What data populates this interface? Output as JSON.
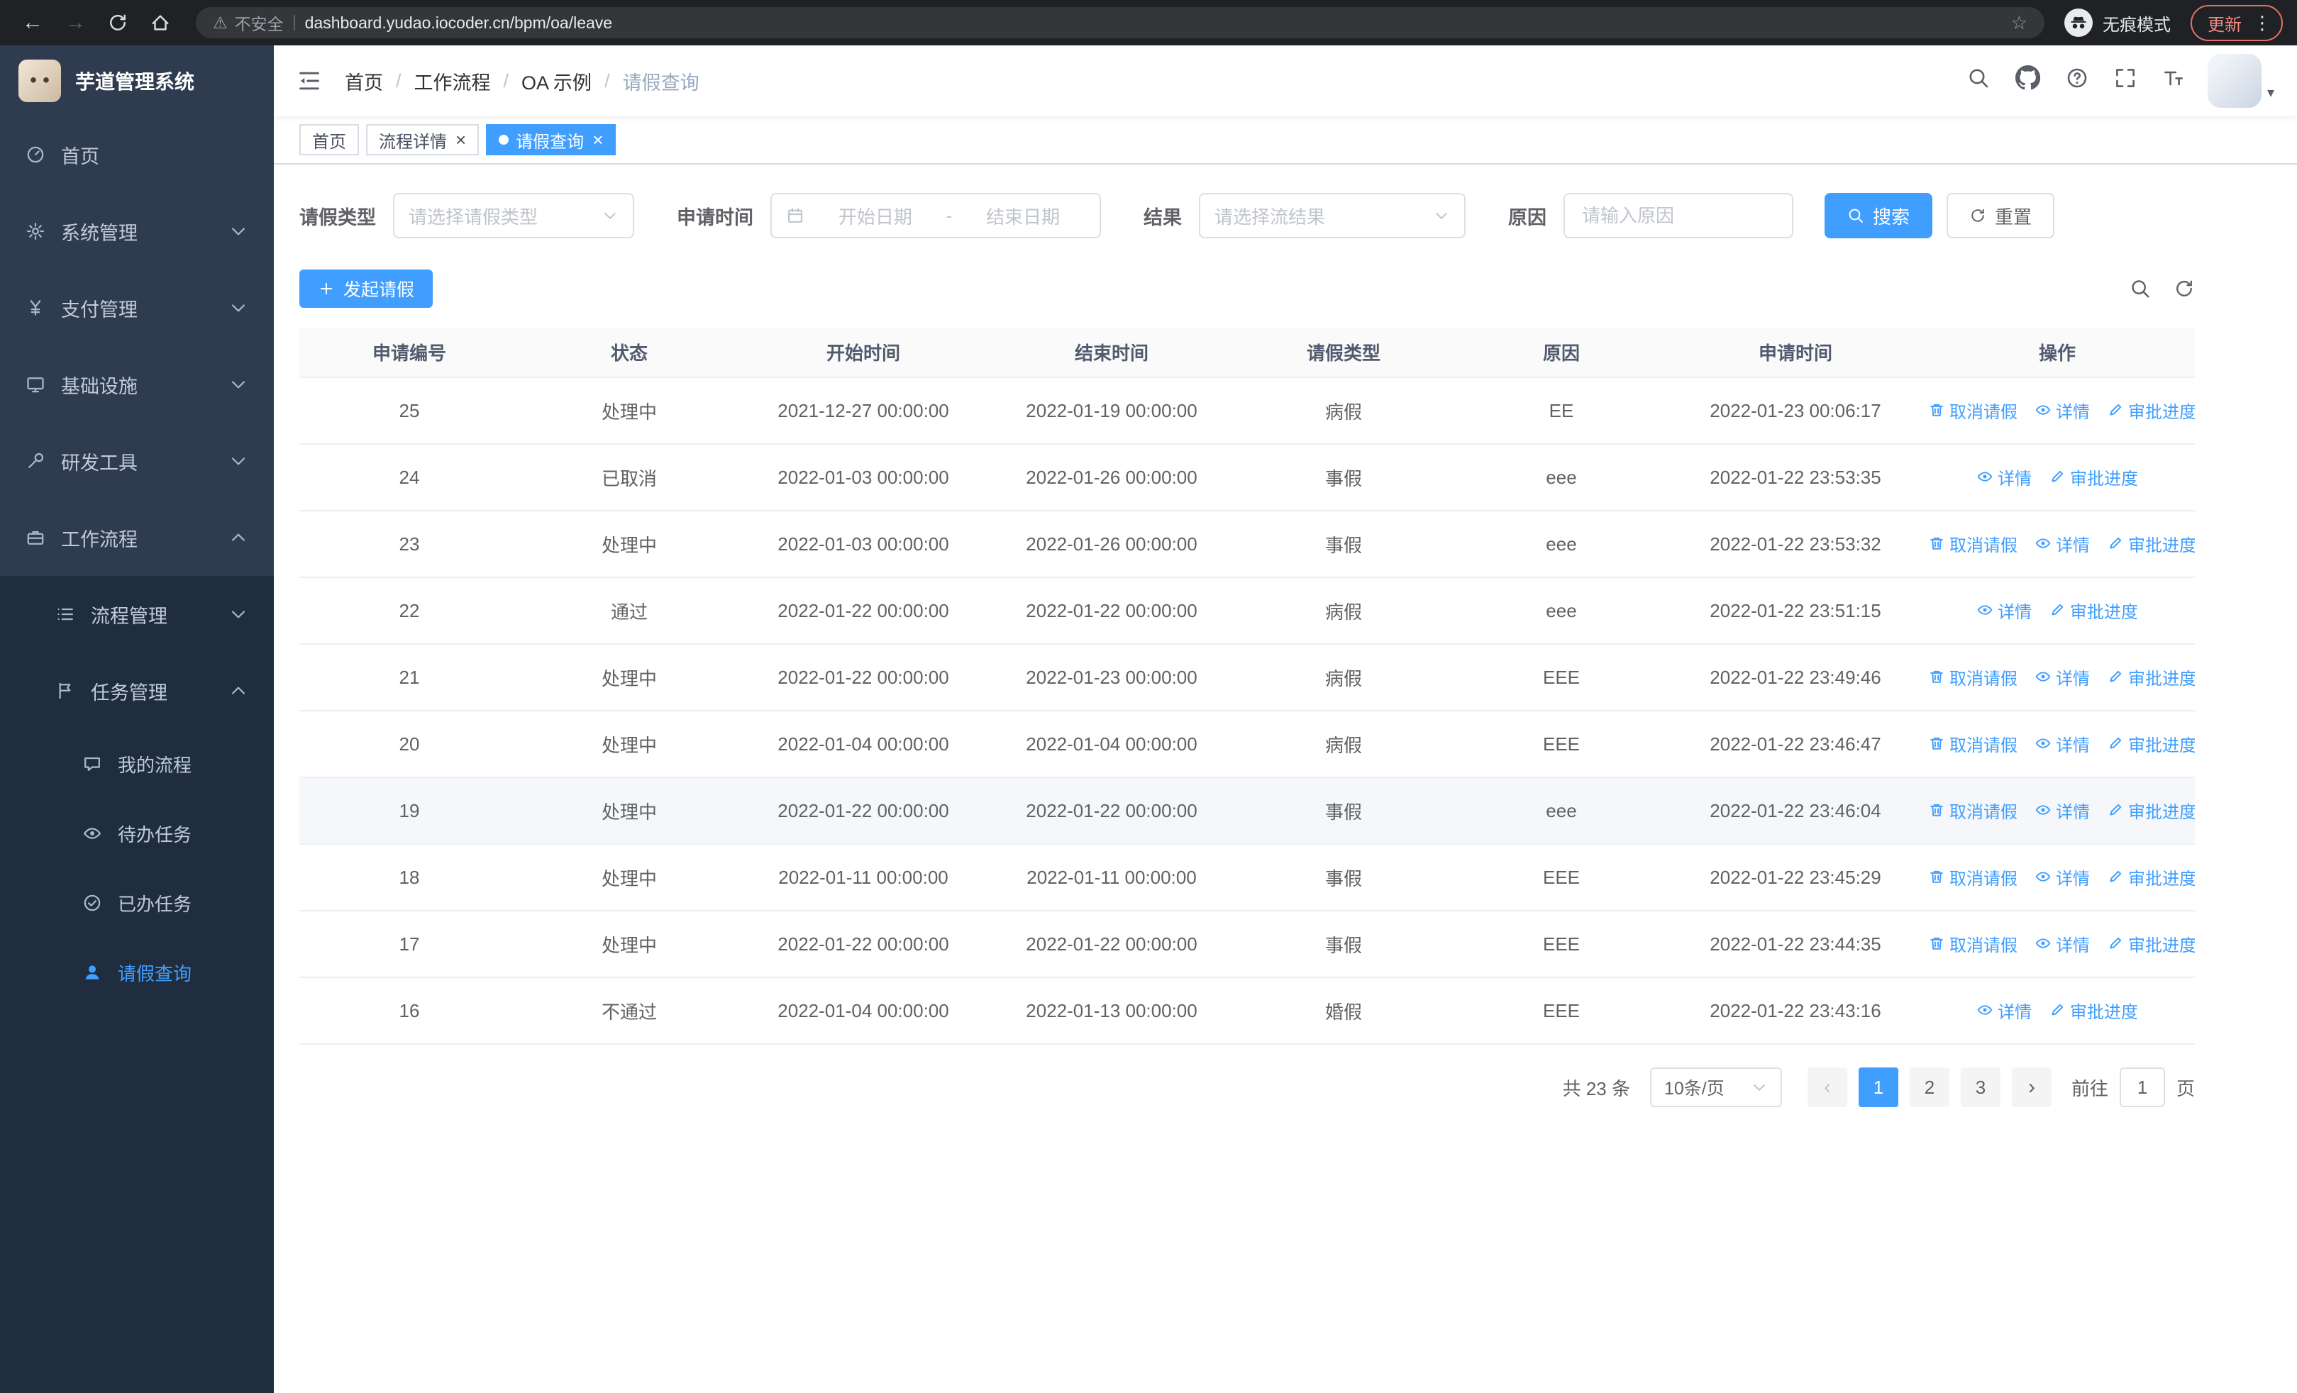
{
  "theme": {
    "primary": "#409EFF",
    "sidebar_bg": "#2f3c4f",
    "submenu_bg": "#1f2d3e"
  },
  "browser": {
    "security_label": "不安全",
    "url": "dashboard.yudao.iocoder.cn/bpm/oa/leave",
    "incognito_label": "无痕模式",
    "update_label": "更新"
  },
  "sidebar": {
    "logo_title": "芋道管理系统",
    "items": [
      {
        "id": "home",
        "label": "首页",
        "icon": "dashboard-icon",
        "expandable": false,
        "expanded": false
      },
      {
        "id": "system",
        "label": "系统管理",
        "icon": "gear-icon",
        "expandable": true,
        "expanded": false
      },
      {
        "id": "payment",
        "label": "支付管理",
        "icon": "payment-icon",
        "expandable": true,
        "expanded": false
      },
      {
        "id": "infrastructure",
        "label": "基础设施",
        "icon": "monitor-icon",
        "expandable": true,
        "expanded": false
      },
      {
        "id": "devtools",
        "label": "研发工具",
        "icon": "tools-icon",
        "expandable": true,
        "expanded": false
      },
      {
        "id": "workflow",
        "label": "工作流程",
        "icon": "briefcase-icon",
        "expandable": true,
        "expanded": true
      }
    ],
    "submenu": [
      {
        "id": "process-mgmt",
        "label": "流程管理",
        "icon": "list-icon",
        "expandable": true,
        "expanded": false
      },
      {
        "id": "task-mgmt",
        "label": "任务管理",
        "icon": "flag-icon",
        "expandable": true,
        "expanded": true
      }
    ],
    "subitems": [
      {
        "id": "my-process",
        "label": "我的流程",
        "icon": "chat-icon",
        "active": false
      },
      {
        "id": "todo-task",
        "label": "待办任务",
        "icon": "eye-icon",
        "active": false
      },
      {
        "id": "done-task",
        "label": "已办任务",
        "icon": "check-circle-icon",
        "active": false
      },
      {
        "id": "leave-query",
        "label": "请假查询",
        "icon": "user-icon",
        "active": true
      }
    ]
  },
  "header": {
    "breadcrumb": [
      "首页",
      "工作流程",
      "OA 示例",
      "请假查询"
    ],
    "action_icons": [
      "search-icon",
      "github-icon",
      "help-icon",
      "fullscreen-icon",
      "font-size-icon"
    ]
  },
  "tabs": [
    {
      "id": "home",
      "label": "首页",
      "closable": false,
      "active": false
    },
    {
      "id": "process-detail",
      "label": "流程详情",
      "closable": true,
      "active": false
    },
    {
      "id": "leave-query",
      "label": "请假查询",
      "closable": true,
      "active": true
    }
  ],
  "filters": {
    "leave_type_label": "请假类型",
    "leave_type_placeholder": "请选择请假类型",
    "apply_time_label": "申请时间",
    "start_date_placeholder": "开始日期",
    "range_separator": "-",
    "end_date_placeholder": "结束日期",
    "result_label": "结果",
    "result_placeholder": "请选择流结果",
    "reason_label": "原因",
    "reason_placeholder": "请输入原因",
    "search_button": "搜索",
    "reset_button": "重置"
  },
  "toolbar": {
    "create_button": "发起请假"
  },
  "table": {
    "columns": [
      "申请编号",
      "状态",
      "开始时间",
      "结束时间",
      "请假类型",
      "原因",
      "申请时间",
      "操作"
    ],
    "actions": {
      "cancel": "取消请假",
      "detail": "详情",
      "progress": "审批进度"
    },
    "rows": [
      {
        "id": "25",
        "status": "处理中",
        "start_time": "2021-12-27 00:00:00",
        "end_time": "2022-01-19 00:00:00",
        "leave_type": "病假",
        "reason": "EE",
        "apply_time": "2022-01-23 00:06:17",
        "cancelable": true,
        "highlighted": false
      },
      {
        "id": "24",
        "status": "已取消",
        "start_time": "2022-01-03 00:00:00",
        "end_time": "2022-01-26 00:00:00",
        "leave_type": "事假",
        "reason": "eee",
        "apply_time": "2022-01-22 23:53:35",
        "cancelable": false,
        "highlighted": false
      },
      {
        "id": "23",
        "status": "处理中",
        "start_time": "2022-01-03 00:00:00",
        "end_time": "2022-01-26 00:00:00",
        "leave_type": "事假",
        "reason": "eee",
        "apply_time": "2022-01-22 23:53:32",
        "cancelable": true,
        "highlighted": false
      },
      {
        "id": "22",
        "status": "通过",
        "start_time": "2022-01-22 00:00:00",
        "end_time": "2022-01-22 00:00:00",
        "leave_type": "病假",
        "reason": "eee",
        "apply_time": "2022-01-22 23:51:15",
        "cancelable": false,
        "highlighted": false
      },
      {
        "id": "21",
        "status": "处理中",
        "start_time": "2022-01-22 00:00:00",
        "end_time": "2022-01-23 00:00:00",
        "leave_type": "病假",
        "reason": "EEE",
        "apply_time": "2022-01-22 23:49:46",
        "cancelable": true,
        "highlighted": false
      },
      {
        "id": "20",
        "status": "处理中",
        "start_time": "2022-01-04 00:00:00",
        "end_time": "2022-01-04 00:00:00",
        "leave_type": "病假",
        "reason": "EEE",
        "apply_time": "2022-01-22 23:46:47",
        "cancelable": true,
        "highlighted": false
      },
      {
        "id": "19",
        "status": "处理中",
        "start_time": "2022-01-22 00:00:00",
        "end_time": "2022-01-22 00:00:00",
        "leave_type": "事假",
        "reason": "eee",
        "apply_time": "2022-01-22 23:46:04",
        "cancelable": true,
        "highlighted": true
      },
      {
        "id": "18",
        "status": "处理中",
        "start_time": "2022-01-11 00:00:00",
        "end_time": "2022-01-11 00:00:00",
        "leave_type": "事假",
        "reason": "EEE",
        "apply_time": "2022-01-22 23:45:29",
        "cancelable": true,
        "highlighted": false
      },
      {
        "id": "17",
        "status": "处理中",
        "start_time": "2022-01-22 00:00:00",
        "end_time": "2022-01-22 00:00:00",
        "leave_type": "事假",
        "reason": "EEE",
        "apply_time": "2022-01-22 23:44:35",
        "cancelable": true,
        "highlighted": false
      },
      {
        "id": "16",
        "status": "不通过",
        "start_time": "2022-01-04 00:00:00",
        "end_time": "2022-01-13 00:00:00",
        "leave_type": "婚假",
        "reason": "EEE",
        "apply_time": "2022-01-22 23:43:16",
        "cancelable": false,
        "highlighted": false
      }
    ]
  },
  "pagination": {
    "total": "共 23 条",
    "page_size": "10条/页",
    "pages": [
      "1",
      "2",
      "3"
    ],
    "active_page": "1",
    "goto_label": "前往",
    "goto_value": "1",
    "page_label": "页"
  }
}
